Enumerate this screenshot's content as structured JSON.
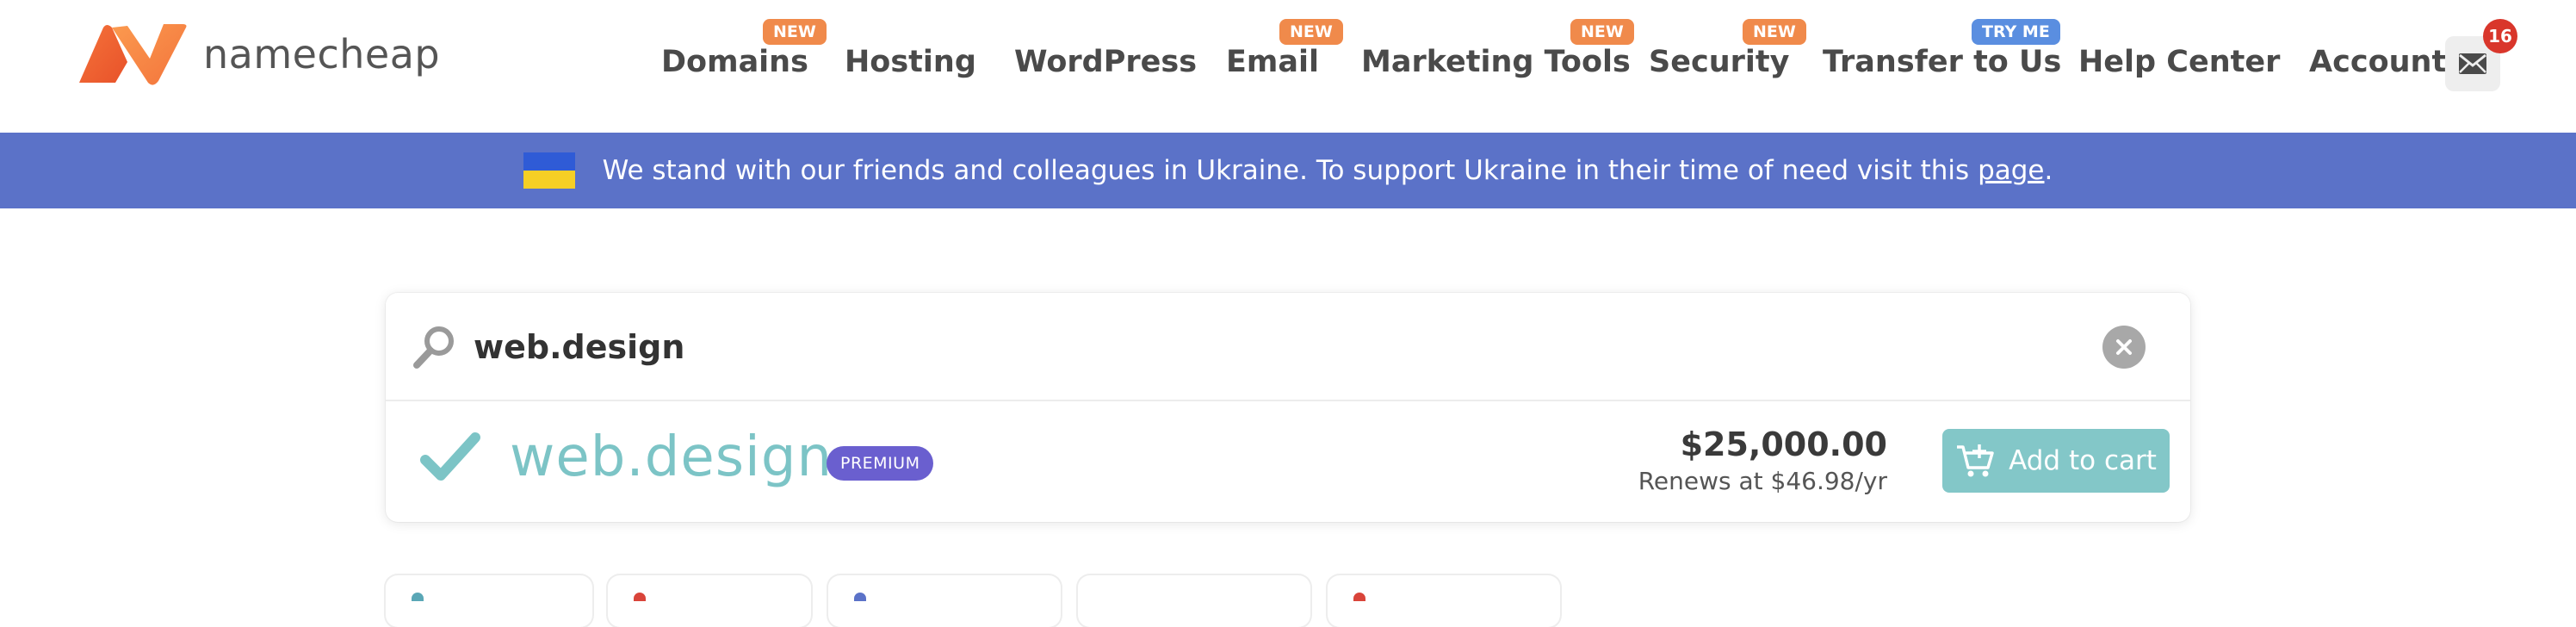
{
  "header": {
    "logo_text": "namecheap",
    "nav": [
      {
        "label": "Domains",
        "badge": "NEW"
      },
      {
        "label": "Hosting",
        "badge": ""
      },
      {
        "label": "WordPress",
        "badge": ""
      },
      {
        "label": "Email",
        "badge": "NEW"
      },
      {
        "label": "Marketing Tools",
        "badge": "NEW"
      },
      {
        "label": "Security",
        "badge": "NEW"
      },
      {
        "label": "Transfer to Us",
        "badge": "TRY ME"
      },
      {
        "label": "Help Center",
        "badge": ""
      },
      {
        "label": "Account",
        "badge": ""
      }
    ],
    "mail_icon": "envelope-icon",
    "mail_count": "16"
  },
  "banner": {
    "text": "We stand with our friends and colleagues in Ukraine. To support Ukraine in their time of need visit this ",
    "link_text": "page",
    "end": "."
  },
  "search": {
    "value": "web.design",
    "search_icon": "search-icon",
    "clear_icon": "close-icon"
  },
  "result": {
    "domain": "web.design",
    "badge": "PREMIUM",
    "price": "$25,000.00",
    "renew": "Renews at $46.98/yr",
    "cart_label": "Add to cart"
  },
  "colors": {
    "banner": "#5b72c8",
    "accent": "#83c7c8",
    "premium": "#6a5fcf",
    "badge_new": "#f08a4b",
    "badge_try": "#5a8ee0"
  }
}
